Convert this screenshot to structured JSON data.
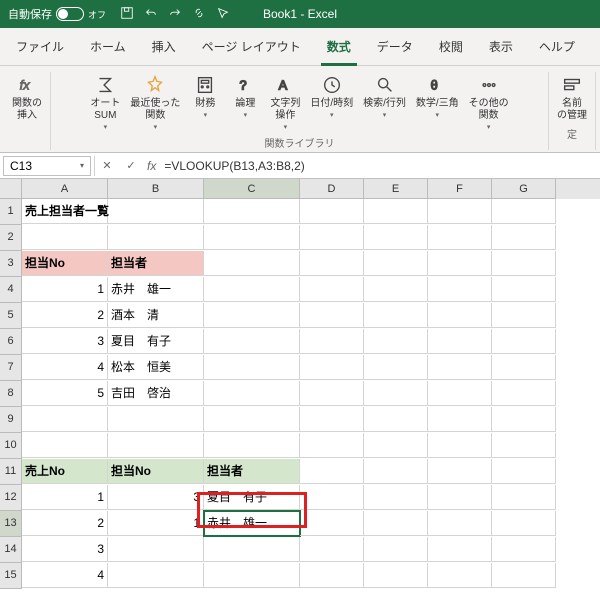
{
  "title": "Book1 - Excel",
  "autosave": "自動保存",
  "tabs": [
    "ファイル",
    "ホーム",
    "挿入",
    "ページ レイアウト",
    "数式",
    "データ",
    "校閲",
    "表示",
    "ヘルプ"
  ],
  "activeTab": 4,
  "ribbon": {
    "fxIns": "関数の\n挿入",
    "sum": "オート\nSUM",
    "recent": "最近使った\n関数",
    "fin": "財務",
    "logic": "論理",
    "text": "文字列\n操作",
    "date": "日付/時刻",
    "lookup": "検索/行列",
    "math": "数学/三角",
    "more": "その他の\n関数",
    "name": "名前\nの管理",
    "grp1": "関数ライブラリ",
    "grp2": "定"
  },
  "nameBox": "C13",
  "formula": "=VLOOKUP(B13,A3:B8,2)",
  "cols": [
    "A",
    "B",
    "C",
    "D",
    "E",
    "F",
    "G"
  ],
  "cells": {
    "A1": "売上担当者一覧",
    "A3": "担当No",
    "B3": "担当者",
    "A4": "1",
    "B4": "赤井　雄一",
    "A5": "2",
    "B5": "酒本　清",
    "A6": "3",
    "B6": "夏目　有子",
    "A7": "4",
    "B7": "松本　恒美",
    "A8": "5",
    "B8": "吉田　啓治",
    "A11": "売上No",
    "B11": "担当No",
    "C11": "担当者",
    "A12": "1",
    "B12": "3",
    "C12": "夏目　有子",
    "A13": "2",
    "B13": "1",
    "C13": "赤井　雄一",
    "A14": "3",
    "A15": "4"
  }
}
